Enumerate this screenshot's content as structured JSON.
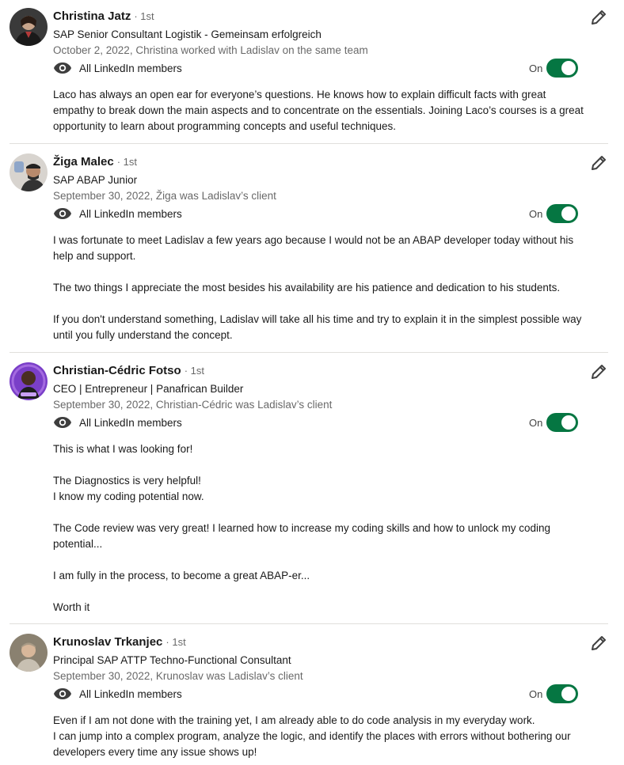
{
  "recommendations": [
    {
      "name": "Christina Jatz",
      "degree": "· 1st",
      "headline": "SAP Senior Consultant Logistik - Gemeinsam erfolgreich",
      "meta": "October 2, 2022, Christina worked with Ladislav on the same team",
      "visibility": "All LinkedIn members",
      "toggle_label": "On",
      "toggle_on": true,
      "paragraphs": [
        "Laco has always an open ear for everyone’s questions. He knows how to explain difficult facts with great empathy to break down the main aspects and to concentrate on the essentials. Joining Laco’s courses is a great opportunity to learn about programming concepts and useful techniques."
      ]
    },
    {
      "name": "Žiga Malec",
      "degree": "· 1st",
      "headline": "SAP ABAP Junior",
      "meta": "September 30, 2022, Žiga was Ladislav’s client",
      "visibility": "All LinkedIn members",
      "toggle_label": "On",
      "toggle_on": true,
      "paragraphs": [
        "I was fortunate to meet Ladislav a few years ago because I would not be an ABAP developer today without his help and support.",
        "The two things I appreciate the most besides his availability are his patience and dedication to his students.",
        "If you don't understand something, Ladislav will take all his time and try to explain it in the simplest possible way until you fully understand the concept."
      ]
    },
    {
      "name": "Christian-Cédric Fotso",
      "degree": "· 1st",
      "headline": "CEO | Entrepreneur | Panafrican Builder",
      "meta": "September 30, 2022, Christian-Cédric was Ladislav’s client",
      "visibility": "All LinkedIn members",
      "toggle_label": "On",
      "toggle_on": true,
      "paragraphs": [
        "This is what I was looking for!",
        "The Diagnostics is very helpful!\nI know my coding potential now.",
        "The Code review was very great! I learned how to increase my coding skills and how to unlock my coding potential...",
        "I am fully in the process, to become a great ABAP-er...",
        "Worth it"
      ]
    },
    {
      "name": "Krunoslav Trkanjec",
      "degree": "· 1st",
      "headline": "Principal SAP ATTP Techno-Functional Consultant",
      "meta": "September 30, 2022, Krunoslav was Ladislav’s client",
      "visibility": "All LinkedIn members",
      "toggle_label": "On",
      "toggle_on": true,
      "paragraphs": [
        "Even if I am not done with the training yet, I am already able to do code analysis in my everyday work.\nI can jump into a complex program, analyze the logic, and identify the places with errors without bothering our developers every time any issue shows up!"
      ]
    }
  ],
  "colors": {
    "toggle_on": "#057642",
    "divider": "#e0dfdc",
    "text_secondary": "rgba(0,0,0,0.6)"
  },
  "icons": {
    "visibility": "eye-icon",
    "edit": "pencil-icon"
  }
}
